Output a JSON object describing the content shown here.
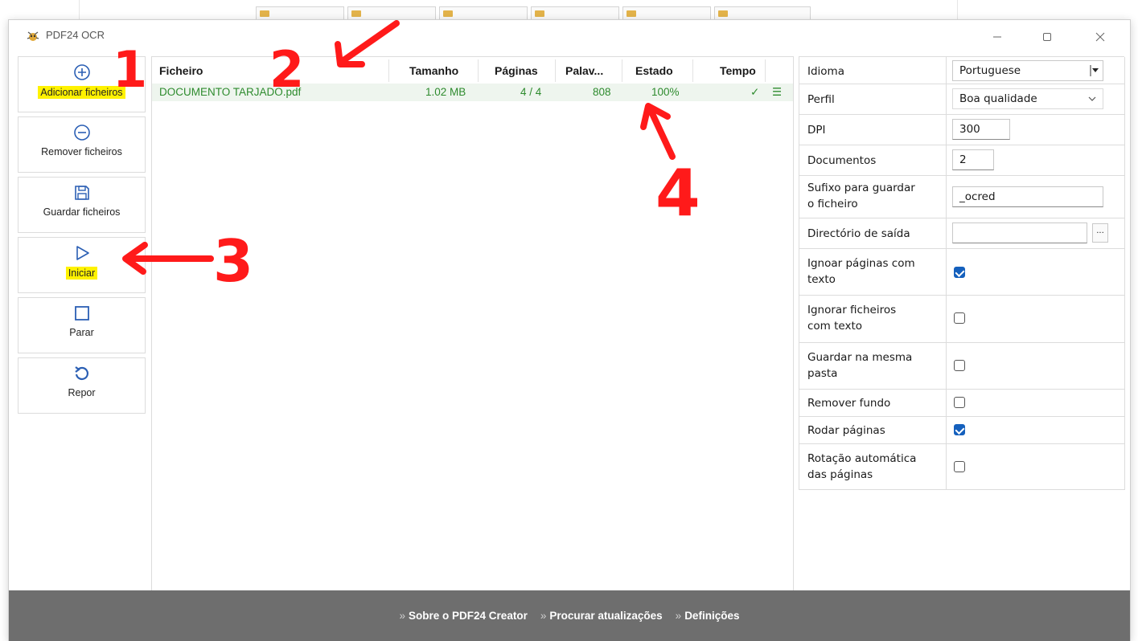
{
  "window": {
    "title": "PDF24 OCR"
  },
  "toolbar": {
    "add_label": "Adicionar ficheiros",
    "remove_label": "Remover ficheiros",
    "save_label": "Guardar ficheiros",
    "start_label": "Iniciar",
    "stop_label": "Parar",
    "reset_label": "Repor"
  },
  "filelist": {
    "headers": {
      "file": "Ficheiro",
      "size": "Tamanho",
      "pages": "Páginas",
      "words": "Palav...",
      "status": "Estado",
      "time": "Tempo"
    },
    "rows": [
      {
        "file": "DOCUMENTO TARJADO.pdf",
        "size": "1.02 MB",
        "pages": "4 / 4",
        "words": "808",
        "status": "100%",
        "time": "✓",
        "menu": "☰"
      }
    ]
  },
  "settings": {
    "language_label": "Idioma",
    "language_value": "Portuguese",
    "profile_label": "Perfil",
    "profile_value": "Boa qualidade",
    "dpi_label": "DPI",
    "dpi_value": "300",
    "documents_label": "Documentos",
    "documents_value": "2",
    "suffix_label_1": "Sufixo para guardar",
    "suffix_label_2": "o ficheiro",
    "suffix_value": "_ocred",
    "outdir_label": "Directório de saída",
    "outdir_value": "",
    "browse_label": "...",
    "skip_pages_label_1": "Ignoar páginas com",
    "skip_pages_label_2": "texto",
    "skip_pages_checked": true,
    "skip_files_label_1": "Ignorar ficheiros",
    "skip_files_label_2": "com texto",
    "skip_files_checked": false,
    "same_folder_label_1": "Guardar na mesma",
    "same_folder_label_2": "pasta",
    "same_folder_checked": false,
    "remove_bg_label": "Remover fundo",
    "remove_bg_checked": false,
    "rotate_label": "Rodar páginas",
    "rotate_checked": true,
    "auto_rotate_label_1": "Rotação automática",
    "auto_rotate_label_2": "das páginas",
    "auto_rotate_checked": false
  },
  "footer": {
    "link_about": "Sobre o PDF24 Creator",
    "link_updates": "Procurar atualizações",
    "link_settings": "Definições",
    "bullet": "»"
  },
  "annotations": {
    "n1": "1",
    "n2": "2",
    "n3": "3",
    "n4": "4",
    "color": "#ff1a1a"
  },
  "colors": {
    "highlight": "#fff200",
    "success_green": "#2e8b2e",
    "checkbox_blue": "#1560bd",
    "footer_gray": "#6e6e6e"
  }
}
